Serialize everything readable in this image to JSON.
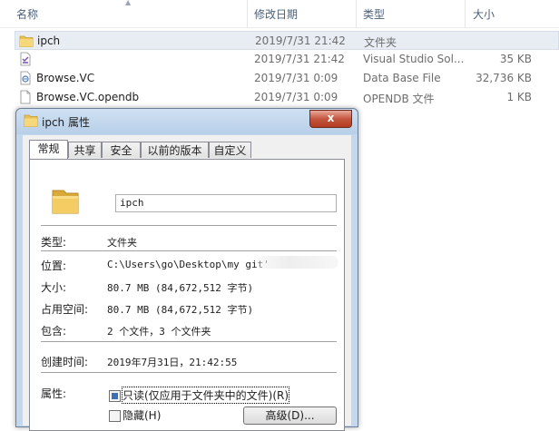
{
  "explorer": {
    "columns": {
      "name": "名称",
      "date": "修改日期",
      "type": "类型",
      "size": "大小"
    },
    "files": [
      {
        "name": "ipch",
        "date": "2019/7/31 21:42",
        "type": "文件夹",
        "size": "",
        "icon": "folder-icon"
      },
      {
        "name": "",
        "date": "2019/7/31 21:42",
        "type": "Visual Studio Sol...",
        "size": "35 KB",
        "icon": "vs-solution-icon"
      },
      {
        "name": "Browse.VC",
        "date": "2019/7/31 0:09",
        "type": "Data Base File",
        "size": "32,736 KB",
        "icon": "database-file-icon"
      },
      {
        "name": "Browse.VC.opendb",
        "date": "2019/7/31 0:09",
        "type": "OPENDB 文件",
        "size": "1 KB",
        "icon": "blank-file-icon"
      }
    ]
  },
  "dialog": {
    "title": "ipch 属性",
    "close": "x",
    "tabs": [
      "常规",
      "共享",
      "安全",
      "以前的版本",
      "自定义"
    ],
    "name_value": "ipch",
    "props": {
      "type_label": "类型:",
      "type_value": "文件夹",
      "location_label": "位置:",
      "location_value": "C:\\Users\\go\\Desktop\\my git'",
      "size_label": "大小:",
      "size_value": "80.7 MB (84,672,512 字节)",
      "disk_label": "占用空间:",
      "disk_value": "80.7 MB (84,672,512 字节)",
      "contains_label": "包含:",
      "contains_value": "2 个文件，3 个文件夹",
      "created_label": "创建时间:",
      "created_value": "2019年7月31日，21:42:55",
      "attr_label": "属性:"
    },
    "readonly_label": "只读(仅应用于文件夹中的文件)(R)",
    "hidden_label": "隐藏(H)",
    "advanced_label": "高级(D)..."
  },
  "colors": {
    "accent": "#3b6fb6",
    "dialog_frame": "#c4d7ec",
    "close_red": "#c4563f"
  }
}
